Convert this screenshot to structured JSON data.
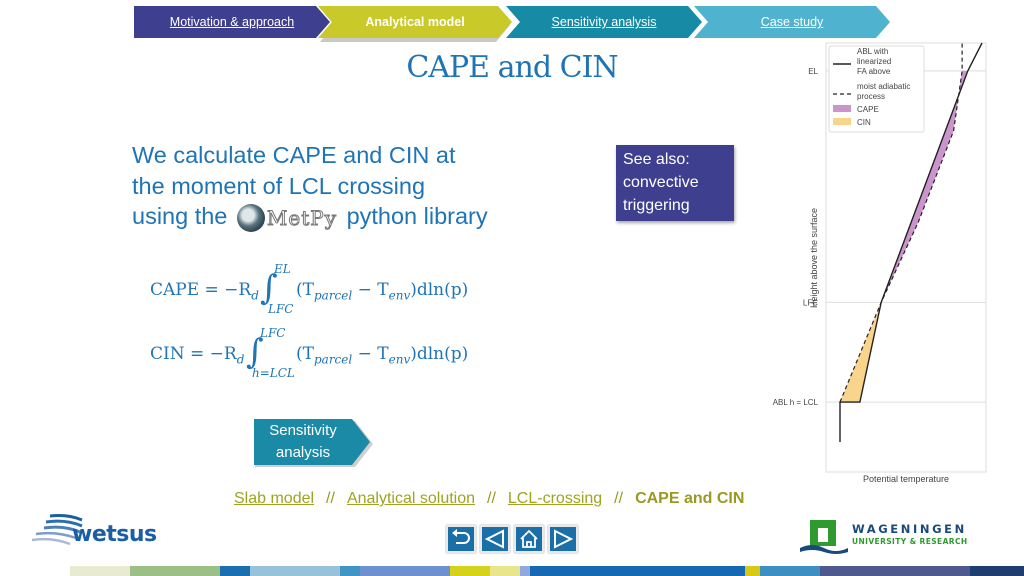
{
  "nav": {
    "steps": [
      {
        "label": "Motivation & approach",
        "color": "#3f3f8f",
        "active": false
      },
      {
        "label": "Analytical model",
        "color": "#c9c92a",
        "active": true
      },
      {
        "label": "Sensitivity analysis",
        "color": "#178aa5",
        "active": false
      },
      {
        "label": "Case study",
        "color": "#4fb3cf",
        "active": false
      }
    ]
  },
  "title": "CAPE and CIN",
  "intro": {
    "line1": "We calculate CAPE and CIN at",
    "line2": "the moment of LCL crossing",
    "line3_before": "using the",
    "logo_text": "MetPy",
    "line3_after": "python library"
  },
  "formulas": {
    "cape": {
      "lhs": "CAPE = −R",
      "lhs_sub": "d",
      "upper": "EL",
      "lower": "LFC",
      "integrand": "(T",
      "t1_sub": "parcel",
      "minus": " − T",
      "t2_sub": "env",
      "tail": ")dln(p)"
    },
    "cin": {
      "lhs": "CIN = −R",
      "lhs_sub": "d",
      "upper": "LFC",
      "lower": "h=LCL",
      "integrand": "(T",
      "t1_sub": "parcel",
      "minus": " − T",
      "t2_sub": "env",
      "tail": ")dln(p)"
    }
  },
  "see_also": {
    "line1": "See also:",
    "line2": "convective",
    "line3": "triggering"
  },
  "sensitivity_button": {
    "line1": "Sensitivity",
    "line2": "analysis"
  },
  "breadcrumb": {
    "links": [
      "Slab model",
      "Analytical solution",
      "LCL-crossing"
    ],
    "separator": "//",
    "current": "CAPE and CIN"
  },
  "chart_data": {
    "type": "line",
    "title": "",
    "xlabel": "Potential temperature",
    "ylabel": "Height above the surface",
    "y_levels": [
      "ABL h = LCL",
      "LFC",
      "EL"
    ],
    "legend": [
      {
        "label": "ABL with linearized FA above",
        "style": "solid",
        "color": "#222222"
      },
      {
        "label": "moist adiabatic process",
        "style": "dashed",
        "color": "#222222"
      },
      {
        "label": "CAPE",
        "style": "fill",
        "color": "#cc94cc"
      },
      {
        "label": "CIN",
        "style": "fill",
        "color": "#f9d48c"
      }
    ],
    "legend_position": "top",
    "grid": "horizontal at levels",
    "series": [
      {
        "name": "ABL with linearized FA above",
        "points": [
          [
            0.0,
            0.0
          ],
          [
            0.0,
            0.1
          ],
          [
            0.14,
            0.1
          ],
          [
            0.29,
            0.35
          ],
          [
            0.9,
            0.93
          ],
          [
            1.0,
            1.0
          ]
        ]
      },
      {
        "name": "moist adiabatic process",
        "points": [
          [
            0.0,
            0.1
          ],
          [
            0.29,
            0.35
          ],
          [
            0.55,
            0.55
          ],
          [
            0.8,
            0.78
          ],
          [
            0.86,
            0.93
          ],
          [
            0.86,
            1.0
          ]
        ]
      }
    ],
    "regions": [
      {
        "name": "CIN",
        "between": [
          "ABL h = LCL",
          "LFC"
        ]
      },
      {
        "name": "CAPE",
        "between": [
          "LFC",
          "EL"
        ]
      }
    ]
  },
  "nav_buttons": [
    {
      "name": "return",
      "icon": "return-icon"
    },
    {
      "name": "previous",
      "icon": "triangle-left-icon"
    },
    {
      "name": "home",
      "icon": "home-icon"
    },
    {
      "name": "next",
      "icon": "triangle-right-icon"
    }
  ],
  "logos": {
    "left": "wetsus",
    "right_name": "WAGENINGEN",
    "right_sub": "UNIVERSITY & RESEARCH"
  },
  "footer_colors": [
    "#ffffff",
    "#e8ebd0",
    "#9cbf88",
    "#1a6fb0",
    "#97c2dc",
    "#3f96c5",
    "#6e8fd0",
    "#d6d11a",
    "#e8e58a",
    "#8fa8e0",
    "#1668b2",
    "#d6c91a",
    "#3d8fc2",
    "#4e5a8e",
    "#1f3e70"
  ]
}
